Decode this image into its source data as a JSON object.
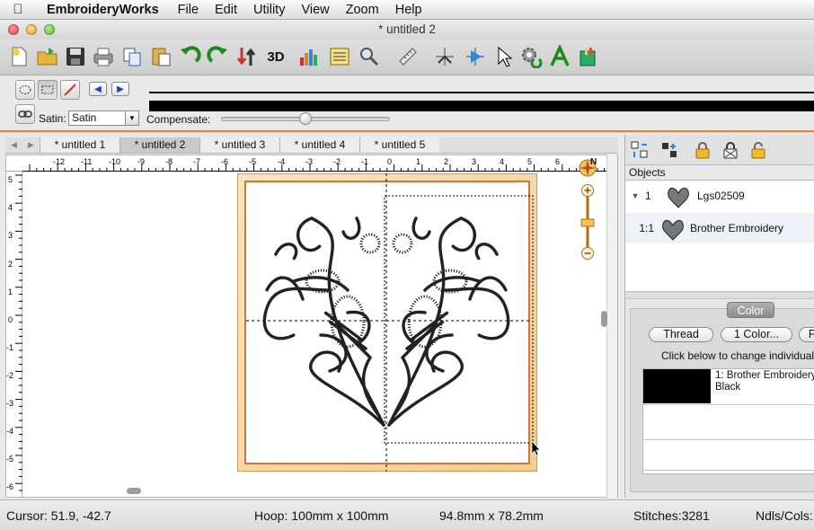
{
  "menubar": {
    "app_name": "EmbroideryWorks",
    "items": [
      "File",
      "Edit",
      "Utility",
      "View",
      "Zoom",
      "Help"
    ]
  },
  "window": {
    "title": "* untitled 2"
  },
  "toolbar": {
    "items": [
      "new-file",
      "open-file",
      "save",
      "print",
      "copy",
      "paste",
      "undo",
      "redo",
      "sort",
      "3D",
      "chart",
      "list",
      "zoom",
      "measure",
      "stitch-tool",
      "arrow-tool",
      "select-arrow",
      "gear-refresh",
      "text-A",
      "thread-bag"
    ],
    "label_3d": "3D"
  },
  "subbar": {
    "satin_label": "Satin:",
    "satin_value": "Satin",
    "compensate_label": "Compensate:",
    "compensate_level": 0.5
  },
  "tabs": [
    "* untitled 1",
    "* untitled 2",
    "* untitled 3",
    "* untitled 4",
    "* untitled 5"
  ],
  "active_tab": 1,
  "rulers": {
    "top": [
      "-12",
      "-11",
      "-10",
      "-9",
      "-8",
      "-7",
      "-6",
      "-5",
      "-4",
      "-3",
      "-2",
      "-1",
      "0",
      "1",
      "2",
      "3",
      "4",
      "5",
      "6"
    ],
    "left": [
      "5",
      "4",
      "3",
      "2",
      "1",
      "0",
      "-1",
      "-2",
      "-3",
      "-4",
      "-5",
      "-6"
    ]
  },
  "compass_label": "N",
  "objects": {
    "header": "Objects",
    "rows": [
      {
        "index": "1",
        "name": "Lgs02509"
      },
      {
        "index": "1:1",
        "name": "Brother Embroidery"
      }
    ]
  },
  "color_panel": {
    "tab": "Color",
    "thread_button": "Thread",
    "one_color_button": "1 Color...",
    "p_button": "P",
    "hint": "Click below to change individual",
    "thread_line1": "1: Brother Embroidery",
    "thread_line2": "Black",
    "swatch_color": "#000000"
  },
  "status": {
    "cursor": "Cursor: 51.9, -42.7",
    "hoop": "Hoop: 100mm x 100mm",
    "size": "94.8mm x 78.2mm",
    "stitches": "Stitches:3281",
    "ndls": "Ndls/Cols:"
  },
  "colors": {
    "accent_orange": "#e9822d",
    "hoop_border": "#c87a3a",
    "hoop_fill": "#f4cb8f"
  }
}
